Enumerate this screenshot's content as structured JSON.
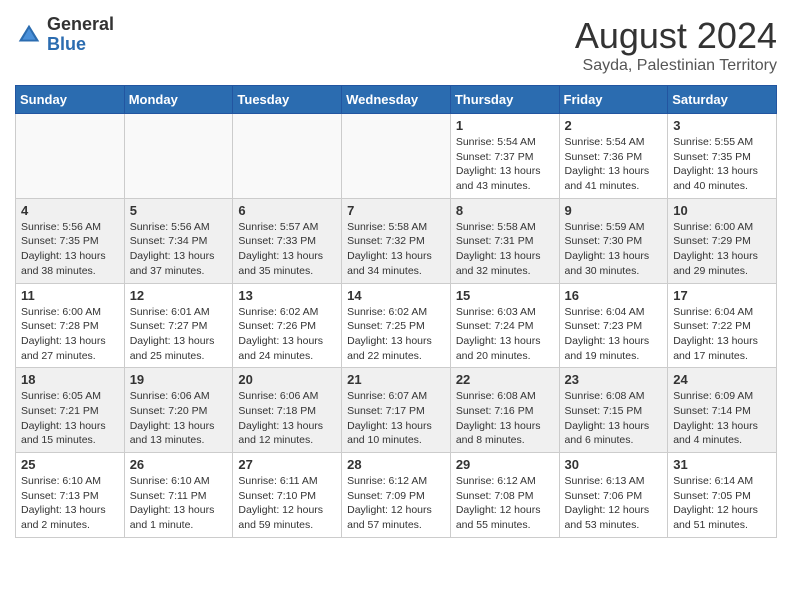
{
  "header": {
    "logo_general": "General",
    "logo_blue": "Blue",
    "month_year": "August 2024",
    "location": "Sayda, Palestinian Territory"
  },
  "days_of_week": [
    "Sunday",
    "Monday",
    "Tuesday",
    "Wednesday",
    "Thursday",
    "Friday",
    "Saturday"
  ],
  "weeks": [
    [
      {
        "day": "",
        "info": ""
      },
      {
        "day": "",
        "info": ""
      },
      {
        "day": "",
        "info": ""
      },
      {
        "day": "",
        "info": ""
      },
      {
        "day": "1",
        "info": "Sunrise: 5:54 AM\nSunset: 7:37 PM\nDaylight: 13 hours\nand 43 minutes."
      },
      {
        "day": "2",
        "info": "Sunrise: 5:54 AM\nSunset: 7:36 PM\nDaylight: 13 hours\nand 41 minutes."
      },
      {
        "day": "3",
        "info": "Sunrise: 5:55 AM\nSunset: 7:35 PM\nDaylight: 13 hours\nand 40 minutes."
      }
    ],
    [
      {
        "day": "4",
        "info": "Sunrise: 5:56 AM\nSunset: 7:35 PM\nDaylight: 13 hours\nand 38 minutes."
      },
      {
        "day": "5",
        "info": "Sunrise: 5:56 AM\nSunset: 7:34 PM\nDaylight: 13 hours\nand 37 minutes."
      },
      {
        "day": "6",
        "info": "Sunrise: 5:57 AM\nSunset: 7:33 PM\nDaylight: 13 hours\nand 35 minutes."
      },
      {
        "day": "7",
        "info": "Sunrise: 5:58 AM\nSunset: 7:32 PM\nDaylight: 13 hours\nand 34 minutes."
      },
      {
        "day": "8",
        "info": "Sunrise: 5:58 AM\nSunset: 7:31 PM\nDaylight: 13 hours\nand 32 minutes."
      },
      {
        "day": "9",
        "info": "Sunrise: 5:59 AM\nSunset: 7:30 PM\nDaylight: 13 hours\nand 30 minutes."
      },
      {
        "day": "10",
        "info": "Sunrise: 6:00 AM\nSunset: 7:29 PM\nDaylight: 13 hours\nand 29 minutes."
      }
    ],
    [
      {
        "day": "11",
        "info": "Sunrise: 6:00 AM\nSunset: 7:28 PM\nDaylight: 13 hours\nand 27 minutes."
      },
      {
        "day": "12",
        "info": "Sunrise: 6:01 AM\nSunset: 7:27 PM\nDaylight: 13 hours\nand 25 minutes."
      },
      {
        "day": "13",
        "info": "Sunrise: 6:02 AM\nSunset: 7:26 PM\nDaylight: 13 hours\nand 24 minutes."
      },
      {
        "day": "14",
        "info": "Sunrise: 6:02 AM\nSunset: 7:25 PM\nDaylight: 13 hours\nand 22 minutes."
      },
      {
        "day": "15",
        "info": "Sunrise: 6:03 AM\nSunset: 7:24 PM\nDaylight: 13 hours\nand 20 minutes."
      },
      {
        "day": "16",
        "info": "Sunrise: 6:04 AM\nSunset: 7:23 PM\nDaylight: 13 hours\nand 19 minutes."
      },
      {
        "day": "17",
        "info": "Sunrise: 6:04 AM\nSunset: 7:22 PM\nDaylight: 13 hours\nand 17 minutes."
      }
    ],
    [
      {
        "day": "18",
        "info": "Sunrise: 6:05 AM\nSunset: 7:21 PM\nDaylight: 13 hours\nand 15 minutes."
      },
      {
        "day": "19",
        "info": "Sunrise: 6:06 AM\nSunset: 7:20 PM\nDaylight: 13 hours\nand 13 minutes."
      },
      {
        "day": "20",
        "info": "Sunrise: 6:06 AM\nSunset: 7:18 PM\nDaylight: 13 hours\nand 12 minutes."
      },
      {
        "day": "21",
        "info": "Sunrise: 6:07 AM\nSunset: 7:17 PM\nDaylight: 13 hours\nand 10 minutes."
      },
      {
        "day": "22",
        "info": "Sunrise: 6:08 AM\nSunset: 7:16 PM\nDaylight: 13 hours\nand 8 minutes."
      },
      {
        "day": "23",
        "info": "Sunrise: 6:08 AM\nSunset: 7:15 PM\nDaylight: 13 hours\nand 6 minutes."
      },
      {
        "day": "24",
        "info": "Sunrise: 6:09 AM\nSunset: 7:14 PM\nDaylight: 13 hours\nand 4 minutes."
      }
    ],
    [
      {
        "day": "25",
        "info": "Sunrise: 6:10 AM\nSunset: 7:13 PM\nDaylight: 13 hours\nand 2 minutes."
      },
      {
        "day": "26",
        "info": "Sunrise: 6:10 AM\nSunset: 7:11 PM\nDaylight: 13 hours\nand 1 minute."
      },
      {
        "day": "27",
        "info": "Sunrise: 6:11 AM\nSunset: 7:10 PM\nDaylight: 12 hours\nand 59 minutes."
      },
      {
        "day": "28",
        "info": "Sunrise: 6:12 AM\nSunset: 7:09 PM\nDaylight: 12 hours\nand 57 minutes."
      },
      {
        "day": "29",
        "info": "Sunrise: 6:12 AM\nSunset: 7:08 PM\nDaylight: 12 hours\nand 55 minutes."
      },
      {
        "day": "30",
        "info": "Sunrise: 6:13 AM\nSunset: 7:06 PM\nDaylight: 12 hours\nand 53 minutes."
      },
      {
        "day": "31",
        "info": "Sunrise: 6:14 AM\nSunset: 7:05 PM\nDaylight: 12 hours\nand 51 minutes."
      }
    ]
  ]
}
